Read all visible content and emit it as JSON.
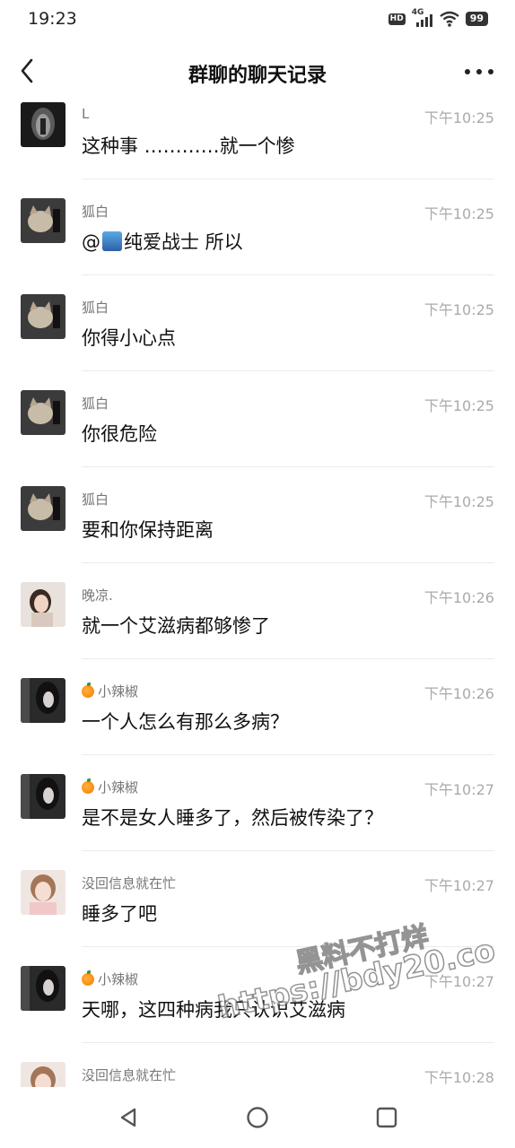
{
  "status_bar": {
    "time": "19:23",
    "hd": "HD",
    "network": "4G",
    "battery": "99"
  },
  "header": {
    "title": "群聊的聊天记录",
    "back_icon": "chevron-left-icon",
    "more_icon": "more-dots-icon"
  },
  "messages": [
    {
      "sender": "L",
      "time": "下午10:25",
      "text": "这种事 …………就一个惨",
      "avatar": "dark-tunnel"
    },
    {
      "sender": "狐白",
      "time": "下午10:25",
      "text_prefix": "@",
      "text_suffix": "纯爱战士 所以",
      "avatar": "cat"
    },
    {
      "sender": "狐白",
      "time": "下午10:25",
      "text": "你得小心点",
      "avatar": "cat"
    },
    {
      "sender": "狐白",
      "time": "下午10:25",
      "text": "你很危险",
      "avatar": "cat"
    },
    {
      "sender": "狐白",
      "time": "下午10:25",
      "text": "要和你保持距离",
      "avatar": "cat"
    },
    {
      "sender": "晚凉.",
      "time": "下午10:26",
      "text": "就一个艾滋病都够惨了",
      "avatar": "girl-portrait"
    },
    {
      "sender": "小辣椒",
      "time": "下午10:26",
      "text": "一个人怎么有那么多病？",
      "avatar": "dark-girl"
    },
    {
      "sender": "小辣椒",
      "time": "下午10:27",
      "text": "是不是女人睡多了，然后被传染了？",
      "avatar": "dark-girl"
    },
    {
      "sender": "没回信息就在忙",
      "time": "下午10:27",
      "text": "睡多了吧",
      "avatar": "light-girl"
    },
    {
      "sender": "小辣椒",
      "time": "下午10:27",
      "text": "天哪，这四种病我只认识艾滋病",
      "avatar": "dark-girl"
    },
    {
      "sender": "没回信息就在忙",
      "time": "下午10:28",
      "text": "",
      "avatar": "light-girl"
    }
  ],
  "watermark": {
    "line1": "黑料不打烊",
    "line2": "https://bdy20.co"
  },
  "nav": {
    "back_icon": "triangle-back-icon",
    "home_icon": "circle-home-icon",
    "recents_icon": "square-recents-icon"
  },
  "colors": {
    "background": "#ffffff",
    "divider": "#ececec",
    "sender": "#777777",
    "time": "#aaaaaa"
  }
}
